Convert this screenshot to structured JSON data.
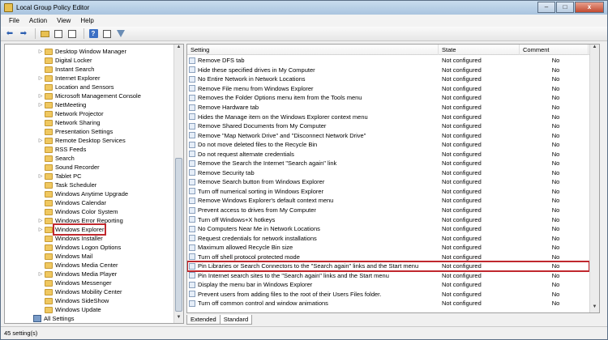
{
  "window": {
    "title": "Local Group Policy Editor",
    "controls": {
      "minimize": "–",
      "maximize": "□",
      "close": "x"
    }
  },
  "menubar": [
    "File",
    "Action",
    "View",
    "Help"
  ],
  "toolbar": [
    "back-arrow",
    "forward-arrow",
    "folder-up",
    "show-hide-tree",
    "export-list",
    "help",
    "properties",
    "filter"
  ],
  "tree": {
    "items": [
      {
        "label": "Desktop Window Manager",
        "expandable": true
      },
      {
        "label": "Digital Locker",
        "expandable": false
      },
      {
        "label": "Instant Search",
        "expandable": false
      },
      {
        "label": "Internet Explorer",
        "expandable": true
      },
      {
        "label": "Location and Sensors",
        "expandable": false
      },
      {
        "label": "Microsoft Management Console",
        "expandable": true
      },
      {
        "label": "NetMeeting",
        "expandable": true
      },
      {
        "label": "Network Projector",
        "expandable": false
      },
      {
        "label": "Network Sharing",
        "expandable": false
      },
      {
        "label": "Presentation Settings",
        "expandable": false
      },
      {
        "label": "Remote Desktop Services",
        "expandable": true
      },
      {
        "label": "RSS Feeds",
        "expandable": false
      },
      {
        "label": "Search",
        "expandable": false
      },
      {
        "label": "Sound Recorder",
        "expandable": false
      },
      {
        "label": "Tablet PC",
        "expandable": true
      },
      {
        "label": "Task Scheduler",
        "expandable": false
      },
      {
        "label": "Windows Anytime Upgrade",
        "expandable": false
      },
      {
        "label": "Windows Calendar",
        "expandable": false
      },
      {
        "label": "Windows Color System",
        "expandable": false
      },
      {
        "label": "Windows Error Reporting",
        "expandable": true
      },
      {
        "label": "Windows Explorer",
        "expandable": true,
        "selected": true
      },
      {
        "label": "Windows Installer",
        "expandable": false
      },
      {
        "label": "Windows Logon Options",
        "expandable": false
      },
      {
        "label": "Windows Mail",
        "expandable": false
      },
      {
        "label": "Windows Media Center",
        "expandable": false
      },
      {
        "label": "Windows Media Player",
        "expandable": true
      },
      {
        "label": "Windows Messenger",
        "expandable": false
      },
      {
        "label": "Windows Mobility Center",
        "expandable": false
      },
      {
        "label": "Windows SideShow",
        "expandable": false
      },
      {
        "label": "Windows Update",
        "expandable": false
      },
      {
        "label": "All Settings",
        "expandable": false,
        "settings_node": true
      }
    ]
  },
  "list": {
    "columns": {
      "setting": "Setting",
      "state": "State",
      "comment": "Comment"
    },
    "rows": [
      {
        "setting": "Remove DFS tab",
        "state": "Not configured",
        "comment": "No"
      },
      {
        "setting": "Hide these specified drives in My Computer",
        "state": "Not configured",
        "comment": "No"
      },
      {
        "setting": "No Entire Network in Network Locations",
        "state": "Not configured",
        "comment": "No"
      },
      {
        "setting": "Remove File menu from Windows Explorer",
        "state": "Not configured",
        "comment": "No"
      },
      {
        "setting": "Removes the Folder Options menu item from the Tools menu",
        "state": "Not configured",
        "comment": "No"
      },
      {
        "setting": "Remove Hardware tab",
        "state": "Not configured",
        "comment": "No"
      },
      {
        "setting": "Hides the Manage item on the Windows Explorer context menu",
        "state": "Not configured",
        "comment": "No"
      },
      {
        "setting": "Remove Shared Documents from My Computer",
        "state": "Not configured",
        "comment": "No"
      },
      {
        "setting": "Remove \"Map Network Drive\" and \"Disconnect Network Drive\"",
        "state": "Not configured",
        "comment": "No"
      },
      {
        "setting": "Do not move deleted files to the Recycle Bin",
        "state": "Not configured",
        "comment": "No"
      },
      {
        "setting": "Do not request alternate credentials",
        "state": "Not configured",
        "comment": "No"
      },
      {
        "setting": "Remove the Search the Internet \"Search again\" link",
        "state": "Not configured",
        "comment": "No"
      },
      {
        "setting": "Remove Security tab",
        "state": "Not configured",
        "comment": "No"
      },
      {
        "setting": "Remove Search button from Windows Explorer",
        "state": "Not configured",
        "comment": "No"
      },
      {
        "setting": "Turn off numerical sorting in Windows Explorer",
        "state": "Not configured",
        "comment": "No"
      },
      {
        "setting": "Remove Windows Explorer's default context menu",
        "state": "Not configured",
        "comment": "No"
      },
      {
        "setting": "Prevent access to drives from My Computer",
        "state": "Not configured",
        "comment": "No"
      },
      {
        "setting": "Turn off Windows+X hotkeys",
        "state": "Not configured",
        "comment": "No"
      },
      {
        "setting": "No Computers Near Me in Network Locations",
        "state": "Not configured",
        "comment": "No"
      },
      {
        "setting": "Request credentials for network installations",
        "state": "Not configured",
        "comment": "No"
      },
      {
        "setting": "Maximum allowed Recycle Bin size",
        "state": "Not configured",
        "comment": "No"
      },
      {
        "setting": "Turn off shell protocol protected mode",
        "state": "Not configured",
        "comment": "No"
      },
      {
        "setting": "Pin Libraries or Search Connectors to the \"Search again\" links and the Start menu",
        "state": "Not configured",
        "comment": "No",
        "highlighted": true
      },
      {
        "setting": "Pin Internet search sites to the \"Search again\" links and the Start menu",
        "state": "Not configured",
        "comment": "No"
      },
      {
        "setting": "Display the menu bar in Windows Explorer",
        "state": "Not configured",
        "comment": "No"
      },
      {
        "setting": "Prevent users from adding files to the root of their Users Files folder.",
        "state": "Not configured",
        "comment": "No"
      },
      {
        "setting": "Turn off common control and window animations",
        "state": "Not configured",
        "comment": "No"
      }
    ]
  },
  "tabs": [
    "Extended",
    "Standard"
  ],
  "status": "45 setting(s)"
}
